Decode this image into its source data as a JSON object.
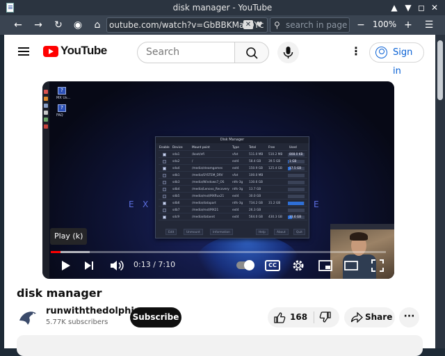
{
  "window": {
    "title": "disk manager - YouTube"
  },
  "browser": {
    "url": "outube.com/watch?v=GbBBKMa-QYc",
    "search_placeholder": "search in page",
    "zoom": "100%"
  },
  "youtube": {
    "logo_text": "YouTube",
    "search_placeholder": "Search",
    "signin_label": "Sign in"
  },
  "player": {
    "tooltip": "Play (k)",
    "time": "0:13 / 7:10",
    "progress_fraction": 0.03,
    "cc_label": "CC",
    "desktop_icons": [
      "MX Us...",
      "FAQ"
    ],
    "background_letters": [
      "E",
      "X",
      "E"
    ]
  },
  "disk_manager": {
    "title": "Disk Manager",
    "columns": [
      "Enable",
      "Device",
      "Mount point",
      "Type",
      "Total",
      "Free",
      "Used"
    ],
    "rows": [
      {
        "enabled": true,
        "device": "sda1",
        "mount": "/boot/efi",
        "type": "vfat",
        "total": "511.0 MB",
        "free": "510.2 MB",
        "used": "808.0 KB",
        "used_fraction": 0.02
      },
      {
        "enabled": false,
        "device": "sda2",
        "mount": "/",
        "type": "ext4",
        "total": "58.4 GB",
        "free": "39.5 GB",
        "used": "1 GB",
        "used_fraction": 0.05
      },
      {
        "enabled": true,
        "device": "sda4",
        "mount": "/media/steamgames",
        "type": "ext4",
        "total": "150.9 GB",
        "free": "125.4 GB",
        "used": "17.5 GB",
        "used_fraction": 0.17
      },
      {
        "enabled": false,
        "device": "sdb1",
        "mount": "/media/SYSTEM_DRV",
        "type": "vfat",
        "total": "100.0 MB",
        "free": "",
        "used": "",
        "used_fraction": 0
      },
      {
        "enabled": false,
        "device": "sdb3",
        "mount": "/media/Windows7_OS",
        "type": "ntfs-3g",
        "total": "130.6 GB",
        "free": "",
        "used": "",
        "used_fraction": 0
      },
      {
        "enabled": false,
        "device": "sdb4",
        "mount": "/media/Lenovo_Recovery",
        "type": "ntfs-3g",
        "total": "13.7 GB",
        "free": "",
        "used": "",
        "used_fraction": 0
      },
      {
        "enabled": false,
        "device": "sdb5",
        "mount": "/media/mxt/MXflux21",
        "type": "ext4",
        "total": "30.0 GB",
        "free": "",
        "used": "",
        "used_fraction": 0
      },
      {
        "enabled": true,
        "device": "sdb6",
        "mount": "/media/datapart",
        "type": "ntfs-3g",
        "total": "734.2 GB",
        "free": "31.2 GB",
        "used": "",
        "used_fraction": 0.96
      },
      {
        "enabled": false,
        "device": "sdb7",
        "mount": "/media/mxt/MX21",
        "type": "ext4",
        "total": "26.3 GB",
        "free": "",
        "used": "",
        "used_fraction": 0
      },
      {
        "enabled": true,
        "device": "sdc9",
        "mount": "/media/dataent",
        "type": "ext4",
        "total": "564.0 GB",
        "free": "430.3 GB",
        "used": "33.6 GB",
        "used_fraction": 0.24
      }
    ],
    "footer_buttons": [
      "Edit",
      "Unmount",
      "Information",
      "Help",
      "About",
      "Quit"
    ]
  },
  "video": {
    "title": "disk manager",
    "channel": "runwiththedolphin",
    "subscribers": "5.77K subscribers",
    "subscribe_label": "Subscribe",
    "likes": "168",
    "share_label": "Share"
  }
}
